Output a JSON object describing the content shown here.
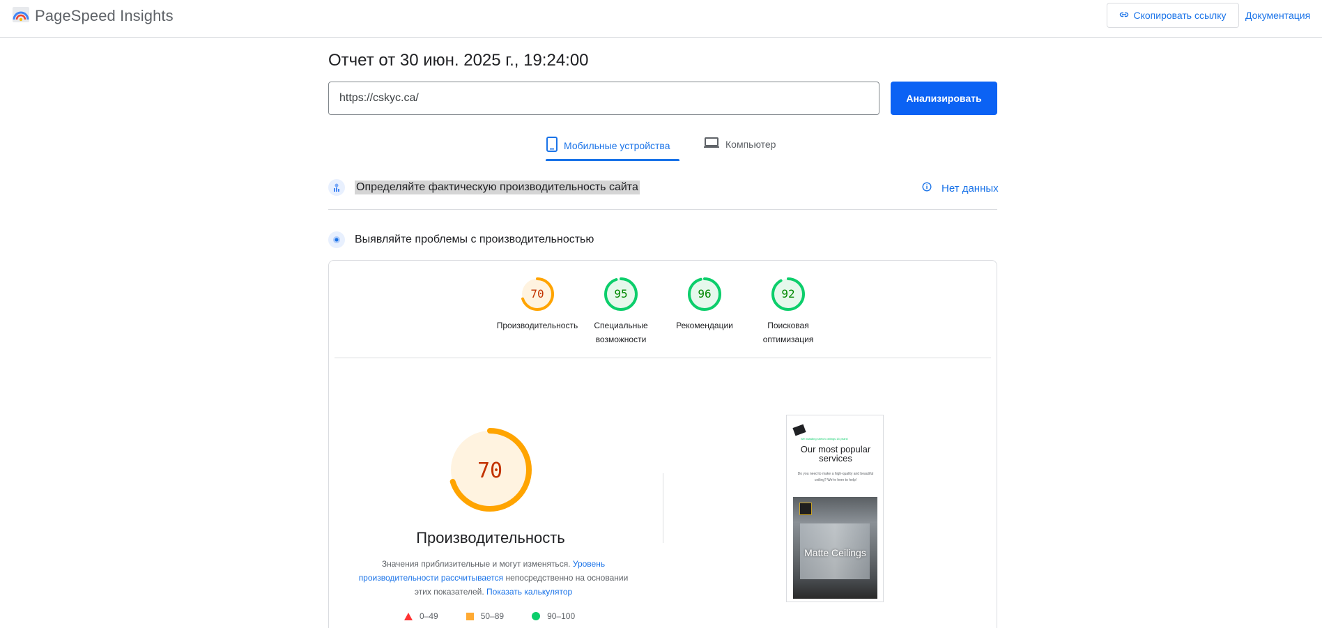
{
  "header": {
    "app_title": "PageSpeed Insights",
    "copy_link_label": "Скопировать ссылку",
    "docs_label": "Документация"
  },
  "report": {
    "title": "Отчет от 30 июн. 2025 г., 19:24:00"
  },
  "search": {
    "url_value": "https://cskyc.ca/",
    "analyze_label": "Анализировать"
  },
  "tabs": [
    {
      "label": "Мобильные устройства",
      "active": true,
      "icon": "smartphone-icon"
    },
    {
      "label": "Компьютер",
      "active": false,
      "icon": "laptop-icon"
    }
  ],
  "field_data": {
    "heading": "Определяйте фактическую производительность сайта",
    "status_label": "Нет данных"
  },
  "lab_data": {
    "heading": "Выявляйте проблемы с производительностью"
  },
  "scores": [
    {
      "value": 70,
      "label": "Производительность",
      "status": "average"
    },
    {
      "value": 95,
      "label": "Специальные возможности",
      "status": "pass"
    },
    {
      "value": 96,
      "label": "Рекомендации",
      "status": "pass"
    },
    {
      "value": 92,
      "label": "Поисковая оптимизация",
      "status": "pass"
    }
  ],
  "performance": {
    "score": 70,
    "title": "Производительность",
    "desc_part1": "Значения приблизительные и могут изменяться.",
    "desc_link1": "Уровень производительности рассчитывается",
    "desc_part2": "непосредственно на основании этих показателей.",
    "desc_link2": "Показать калькулятор"
  },
  "legend": [
    {
      "range": "0–49",
      "shape": "triangle",
      "color": "#ff3333"
    },
    {
      "range": "50–89",
      "shape": "square",
      "color": "#ffaa33"
    },
    {
      "range": "90–100",
      "shape": "circle",
      "color": "#0cce6b"
    }
  ],
  "preview": {
    "tagline": "We installing stretch ceilings 15 years!",
    "title": "Our most popular services",
    "subtitle": "Do you need to make a high-quality and beautiful ceiling? We're here to help!",
    "photo_caption": "Matte Ceilings"
  },
  "colors": {
    "accent": "#1a73e8",
    "button": "#0b62f4",
    "average": "#ffa400",
    "average_text": "#c33300",
    "average_bg": "#fff3e0",
    "pass": "#0cce6b",
    "pass_text": "#008800",
    "pass_bg": "#e6f8ec"
  }
}
